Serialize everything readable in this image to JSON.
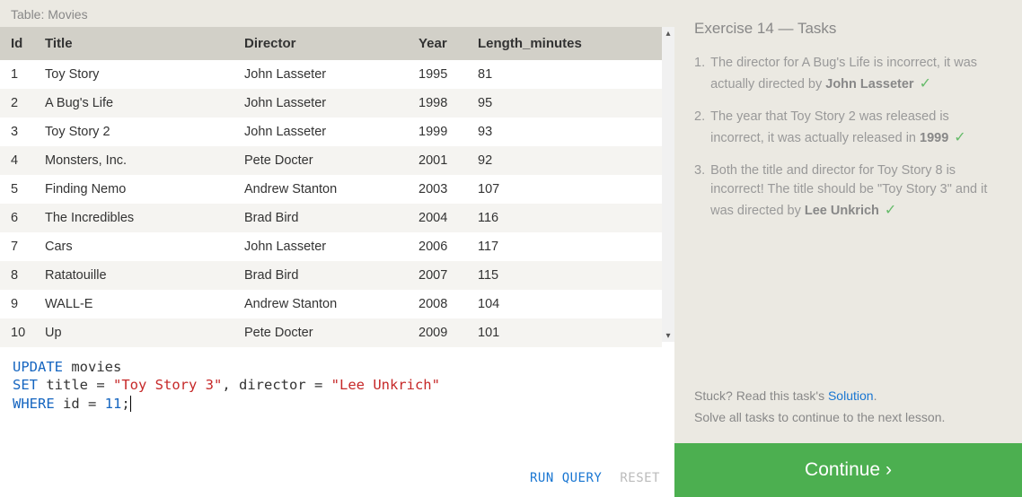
{
  "table": {
    "label": "Table: Movies",
    "columns": [
      "Id",
      "Title",
      "Director",
      "Year",
      "Length_minutes"
    ],
    "rows": [
      {
        "id": "1",
        "title": "Toy Story",
        "director": "John Lasseter",
        "year": "1995",
        "len": "81"
      },
      {
        "id": "2",
        "title": "A Bug's Life",
        "director": "John Lasseter",
        "year": "1998",
        "len": "95"
      },
      {
        "id": "3",
        "title": "Toy Story 2",
        "director": "John Lasseter",
        "year": "1999",
        "len": "93"
      },
      {
        "id": "4",
        "title": "Monsters, Inc.",
        "director": "Pete Docter",
        "year": "2001",
        "len": "92"
      },
      {
        "id": "5",
        "title": "Finding Nemo",
        "director": "Andrew Stanton",
        "year": "2003",
        "len": "107"
      },
      {
        "id": "6",
        "title": "The Incredibles",
        "director": "Brad Bird",
        "year": "2004",
        "len": "116"
      },
      {
        "id": "7",
        "title": "Cars",
        "director": "John Lasseter",
        "year": "2006",
        "len": "117"
      },
      {
        "id": "8",
        "title": "Ratatouille",
        "director": "Brad Bird",
        "year": "2007",
        "len": "115"
      },
      {
        "id": "9",
        "title": "WALL-E",
        "director": "Andrew Stanton",
        "year": "2008",
        "len": "104"
      },
      {
        "id": "10",
        "title": "Up",
        "director": "Pete Docter",
        "year": "2009",
        "len": "101"
      }
    ]
  },
  "editor": {
    "tokens": {
      "update": "UPDATE",
      "movies": " movies",
      "set": "SET",
      "title_eq": " title = ",
      "title_val": "\"Toy Story 3\"",
      "comma_dir": ", director = ",
      "director_val": "\"Lee Unkrich\"",
      "where": "WHERE",
      "id_eq": " id = ",
      "id_val": "11",
      "semi": ";"
    },
    "run_label": "RUN QUERY",
    "reset_label": "RESET"
  },
  "exercise": {
    "title": "Exercise 14 — Tasks",
    "tasks": [
      {
        "pre": "The director for A Bug's Life is incorrect, it was actually directed by ",
        "bold": "John Lasseter",
        "post": "",
        "check": true
      },
      {
        "pre": "The year that Toy Story 2 was released is incorrect, it was actually released in ",
        "bold": "1999",
        "post": "",
        "check": true
      },
      {
        "pre": "Both the title and director for Toy Story 8 is incorrect! The title should be \"Toy Story 3\" and it was directed by ",
        "bold": "Lee Unkrich",
        "post": "",
        "check": true
      }
    ],
    "stuck_pre": "Stuck? Read this task's ",
    "stuck_link": "Solution",
    "stuck_post": ".",
    "solve_all": "Solve all tasks to continue to the next lesson.",
    "continue_label": "Continue ›"
  }
}
